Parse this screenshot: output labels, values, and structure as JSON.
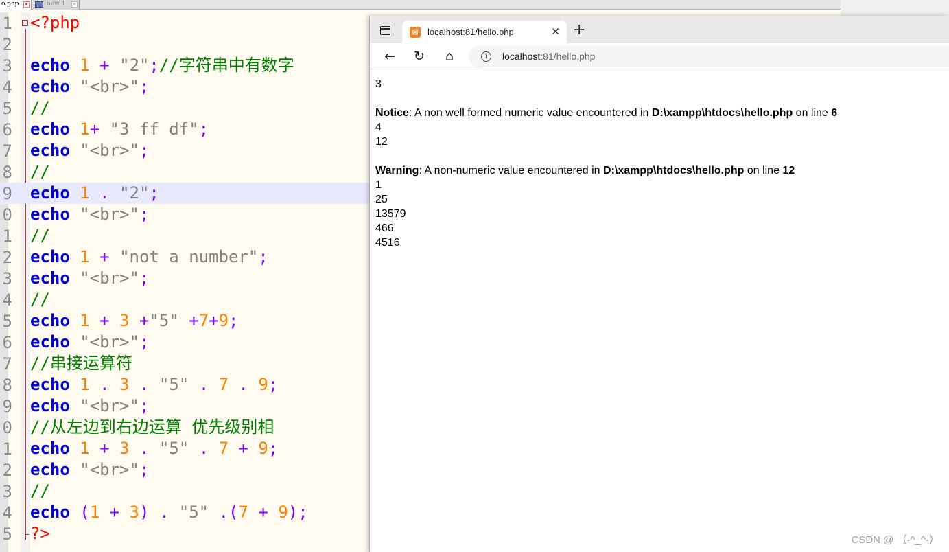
{
  "editor": {
    "tabs": [
      {
        "label": "o.php",
        "active": true
      },
      {
        "label": "new 1",
        "active": false
      }
    ],
    "line_numbers": [
      "1",
      "2",
      "3",
      "4",
      "5",
      "6",
      "7",
      "8",
      "9",
      "0",
      "1",
      "2",
      "3",
      "4",
      "5",
      "6",
      "7",
      "8",
      "9",
      "0",
      "1",
      "2",
      "3",
      "4",
      "5"
    ],
    "highlighted_line": 9,
    "colors": {
      "keyword": "#0000d8",
      "number": "#ff8000",
      "string": "#808080",
      "operator": "#8000ff",
      "comment": "#008000",
      "tag": "#ff0000",
      "highlight": "#e8e8ff"
    },
    "lines": [
      [
        [
          "tag",
          "<?php"
        ]
      ],
      [],
      [
        [
          "kw",
          "echo"
        ],
        [
          "pl",
          " "
        ],
        [
          "num",
          "1"
        ],
        [
          "pl",
          " "
        ],
        [
          "op",
          "+"
        ],
        [
          "pl",
          " "
        ],
        [
          "str",
          "\"2\""
        ],
        [
          "op",
          ";"
        ],
        [
          "cmt",
          "//字符串中有数字"
        ]
      ],
      [
        [
          "kw",
          "echo"
        ],
        [
          "pl",
          " "
        ],
        [
          "str",
          "\"<br>\""
        ],
        [
          "op",
          ";"
        ]
      ],
      [
        [
          "cmt",
          "//"
        ]
      ],
      [
        [
          "kw",
          "echo"
        ],
        [
          "pl",
          " "
        ],
        [
          "num",
          "1"
        ],
        [
          "op",
          "+"
        ],
        [
          "pl",
          " "
        ],
        [
          "str",
          "\"3 ff df\""
        ],
        [
          "op",
          ";"
        ]
      ],
      [
        [
          "kw",
          "echo"
        ],
        [
          "pl",
          " "
        ],
        [
          "str",
          "\"<br>\""
        ],
        [
          "op",
          ";"
        ]
      ],
      [
        [
          "cmt",
          "//"
        ]
      ],
      [
        [
          "kw",
          "echo"
        ],
        [
          "pl",
          " "
        ],
        [
          "num",
          "1"
        ],
        [
          "pl",
          " "
        ],
        [
          "op",
          "."
        ],
        [
          "pl",
          " "
        ],
        [
          "str",
          "\"2\""
        ],
        [
          "op",
          ";"
        ]
      ],
      [
        [
          "kw",
          "echo"
        ],
        [
          "pl",
          " "
        ],
        [
          "str",
          "\"<br>\""
        ],
        [
          "op",
          ";"
        ]
      ],
      [
        [
          "cmt",
          "//"
        ]
      ],
      [
        [
          "kw",
          "echo"
        ],
        [
          "pl",
          " "
        ],
        [
          "num",
          "1"
        ],
        [
          "pl",
          " "
        ],
        [
          "op",
          "+"
        ],
        [
          "pl",
          " "
        ],
        [
          "str",
          "\"not a number\""
        ],
        [
          "op",
          ";"
        ]
      ],
      [
        [
          "kw",
          "echo"
        ],
        [
          "pl",
          " "
        ],
        [
          "str",
          "\"<br>\""
        ],
        [
          "op",
          ";"
        ]
      ],
      [
        [
          "cmt",
          "//"
        ]
      ],
      [
        [
          "kw",
          "echo"
        ],
        [
          "pl",
          " "
        ],
        [
          "num",
          "1"
        ],
        [
          "pl",
          " "
        ],
        [
          "op",
          "+"
        ],
        [
          "pl",
          " "
        ],
        [
          "num",
          "3"
        ],
        [
          "pl",
          " "
        ],
        [
          "op",
          "+"
        ],
        [
          "str",
          "\"5\""
        ],
        [
          "pl",
          " "
        ],
        [
          "op",
          "+"
        ],
        [
          "num",
          "7"
        ],
        [
          "op",
          "+"
        ],
        [
          "num",
          "9"
        ],
        [
          "op",
          ";"
        ]
      ],
      [
        [
          "kw",
          "echo"
        ],
        [
          "pl",
          " "
        ],
        [
          "str",
          "\"<br>\""
        ],
        [
          "op",
          ";"
        ]
      ],
      [
        [
          "cmt",
          "//串接运算符"
        ]
      ],
      [
        [
          "kw",
          "echo"
        ],
        [
          "pl",
          " "
        ],
        [
          "num",
          "1"
        ],
        [
          "pl",
          " "
        ],
        [
          "op",
          "."
        ],
        [
          "pl",
          " "
        ],
        [
          "num",
          "3"
        ],
        [
          "pl",
          " "
        ],
        [
          "op",
          "."
        ],
        [
          "pl",
          " "
        ],
        [
          "str",
          "\"5\""
        ],
        [
          "pl",
          " "
        ],
        [
          "op",
          "."
        ],
        [
          "pl",
          " "
        ],
        [
          "num",
          "7"
        ],
        [
          "pl",
          " "
        ],
        [
          "op",
          "."
        ],
        [
          "pl",
          " "
        ],
        [
          "num",
          "9"
        ],
        [
          "op",
          ";"
        ]
      ],
      [
        [
          "kw",
          "echo"
        ],
        [
          "pl",
          " "
        ],
        [
          "str",
          "\"<br>\""
        ],
        [
          "op",
          ";"
        ]
      ],
      [
        [
          "cmt",
          "//从左边到右边运算 优先级别相"
        ]
      ],
      [
        [
          "kw",
          "echo"
        ],
        [
          "pl",
          " "
        ],
        [
          "num",
          "1"
        ],
        [
          "pl",
          " "
        ],
        [
          "op",
          "+"
        ],
        [
          "pl",
          " "
        ],
        [
          "num",
          "3"
        ],
        [
          "pl",
          " "
        ],
        [
          "op",
          "."
        ],
        [
          "pl",
          " "
        ],
        [
          "str",
          "\"5\""
        ],
        [
          "pl",
          " "
        ],
        [
          "op",
          "."
        ],
        [
          "pl",
          " "
        ],
        [
          "num",
          "7"
        ],
        [
          "pl",
          " "
        ],
        [
          "op",
          "+"
        ],
        [
          "pl",
          " "
        ],
        [
          "num",
          "9"
        ],
        [
          "op",
          ";"
        ]
      ],
      [
        [
          "kw",
          "echo"
        ],
        [
          "pl",
          " "
        ],
        [
          "str",
          "\"<br>\""
        ],
        [
          "op",
          ";"
        ]
      ],
      [
        [
          "cmt",
          "//"
        ]
      ],
      [
        [
          "kw",
          "echo"
        ],
        [
          "pl",
          " "
        ],
        [
          "op",
          "("
        ],
        [
          "num",
          "1"
        ],
        [
          "pl",
          " "
        ],
        [
          "op",
          "+"
        ],
        [
          "pl",
          " "
        ],
        [
          "num",
          "3"
        ],
        [
          "op",
          ")"
        ],
        [
          "pl",
          " "
        ],
        [
          "op",
          "."
        ],
        [
          "pl",
          " "
        ],
        [
          "str",
          "\"5\""
        ],
        [
          "pl",
          " "
        ],
        [
          "op",
          ".("
        ],
        [
          "num",
          "7"
        ],
        [
          "pl",
          " "
        ],
        [
          "op",
          "+"
        ],
        [
          "pl",
          " "
        ],
        [
          "num",
          "9"
        ],
        [
          "op",
          ");"
        ]
      ],
      [
        [
          "tag",
          "?>"
        ]
      ]
    ]
  },
  "browser": {
    "tab_title": "localhost:81/hello.php",
    "tab_close": "✕",
    "new_tab": "+",
    "nav": {
      "back": "←",
      "reload": "↻",
      "home": "⌂"
    },
    "info_glyph": "i",
    "url_host": "localhost",
    "url_path": ":81/hello.php",
    "output": {
      "l1": "3",
      "notice_label": "Notice",
      "notice_text": ": A non well formed numeric value encountered in ",
      "notice_file": "D:\\xampp\\htdocs\\hello.php",
      "notice_on": " on line ",
      "notice_line": "6",
      "l2": "4",
      "l3": "12",
      "warning_label": "Warning",
      "warning_text": ": A non-numeric value encountered in ",
      "warning_file": "D:\\xampp\\htdocs\\hello.php",
      "warning_on": " on line ",
      "warning_line": "12",
      "l4": "1",
      "l5": "25",
      "l6": "13579",
      "l7": "466",
      "l8": "4516"
    }
  },
  "watermark": "CSDN @ （-^_^-）"
}
